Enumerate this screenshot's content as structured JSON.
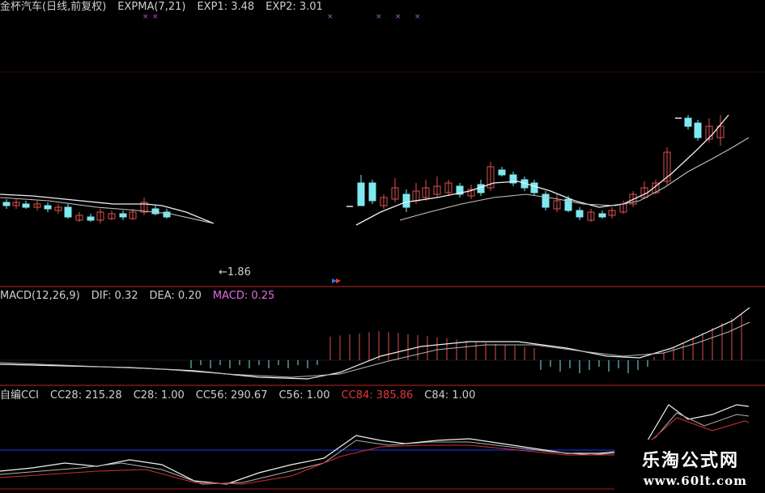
{
  "price_panel": {
    "header": {
      "stock": "金杯汽车(日线,前复权)",
      "indicator": "EXPMA(7,21)",
      "exp1": "EXP1: 3.48",
      "exp2": "EXP2: 3.01"
    },
    "low_marker": "←1.86"
  },
  "macd_panel": {
    "indicator": "MACD(12,26,9)",
    "dif": "DIF: 0.32",
    "dea": "DEA: 0.20",
    "macd": "MACD: 0.25"
  },
  "cci_panel": {
    "indicator": "自编CCI",
    "cc28": "CC28: 215.28",
    "c28": "C28: 1.00",
    "cc56": "CC56: 290.67",
    "c56": "C56: 1.00",
    "cc84": "CC84: 385.86",
    "c84": "C84: 1.00"
  },
  "watermark": {
    "title": "乐淘公式网",
    "url": "www.60lt.com"
  },
  "colors": {
    "up_candle": "#e05050",
    "down_candle": "#7fe8f0",
    "exp1_line": "#f0f0f0",
    "exp2_line": "#c0c0c0",
    "panel_divider": "#9a1c1c",
    "cci_baseline": "#1c2cc8",
    "cc84_line": "#c83030",
    "macd_label": "#e06ce0"
  }
}
